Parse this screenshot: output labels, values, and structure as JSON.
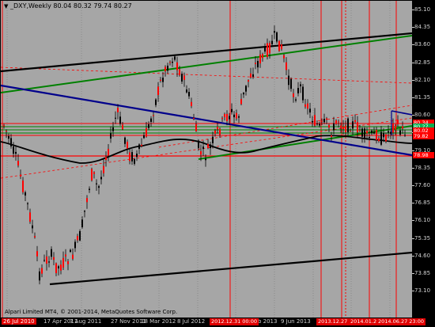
{
  "window": {
    "symbol_info": "_DXY,Weekly  80.04 80.32 79.74 80.27",
    "credits": "Alpari Limited MT4, © 2001-2014, MetaQuotes Software Corp.",
    "icon": "triangle-down-icon"
  },
  "colors": {
    "background": "#a6a6a6",
    "frame": "#000000",
    "bull_candle": "#000000",
    "bear_candle": "#ff0000",
    "upper_channel": "#000000",
    "green_line": "#008000",
    "blue_trend": "#00008b",
    "red_line": "#ff0000",
    "tag_red": "#ff0000",
    "tag_green": "#00b050"
  },
  "price_scale": {
    "labels": [
      "85.10",
      "84.35",
      "83.60",
      "82.85",
      "82.10",
      "81.35",
      "80.60",
      "79.85",
      "79.10",
      "78.35",
      "77.60",
      "76.85",
      "76.10",
      "75.35",
      "74.60",
      "73.85",
      "73.10"
    ],
    "tags": [
      {
        "text": "80.34",
        "color": "#ff0000"
      },
      {
        "text": "80.27",
        "color": "#00b050"
      },
      {
        "text": "80.02",
        "color": "#ff0000"
      },
      {
        "text": "79.82",
        "color": "#ff0000"
      },
      {
        "text": "78.98",
        "color": "#ff0000"
      }
    ]
  },
  "time_scale": {
    "labels": [
      "26 Jul 2010",
      "17 Apr 2011",
      "7 Aug 2011",
      "27 Nov 2011",
      "18 Mar 2012",
      "8 Jul 2012",
      "Feb 2013",
      "9 Jun 2013"
    ],
    "tags": [
      "2012.12.31 00:00",
      "2013.12.27",
      "2014.01.28",
      "2014.06.27 23:00"
    ]
  }
}
